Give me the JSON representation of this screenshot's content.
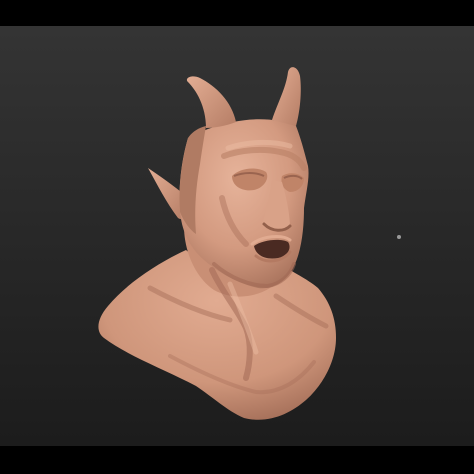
{
  "app": {
    "letterbox_color": "#000000"
  },
  "viewport": {
    "background_top": "#333333",
    "background_bottom": "#1d1d1d",
    "cursor_color": "#9a9a9a"
  },
  "model": {
    "name": "sculpted-horned-demon-bust",
    "skin_color": "#d39a80",
    "highlight_color": "#e8b59c",
    "shadow_color": "#8a5a47",
    "deep_shadow_color": "#4a2a22"
  }
}
